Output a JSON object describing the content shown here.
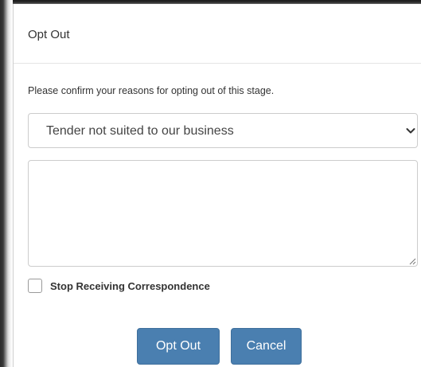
{
  "dialog": {
    "title": "Opt Out",
    "prompt": "Please confirm your reasons for opting out of this stage.",
    "reason_select": {
      "selected": "Tender not suited to our business"
    },
    "comments": {
      "value": ""
    },
    "stop_correspondence": {
      "label": "Stop Receiving Correspondence",
      "checked": false
    },
    "buttons": {
      "opt_out": "Opt Out",
      "cancel": "Cancel"
    }
  },
  "colors": {
    "primary_button": "#4a7fb0",
    "text": "#333333",
    "border": "#cccccc"
  },
  "icons": {
    "dropdown": "chevron-down-icon",
    "resize": "resize-grip-icon"
  }
}
